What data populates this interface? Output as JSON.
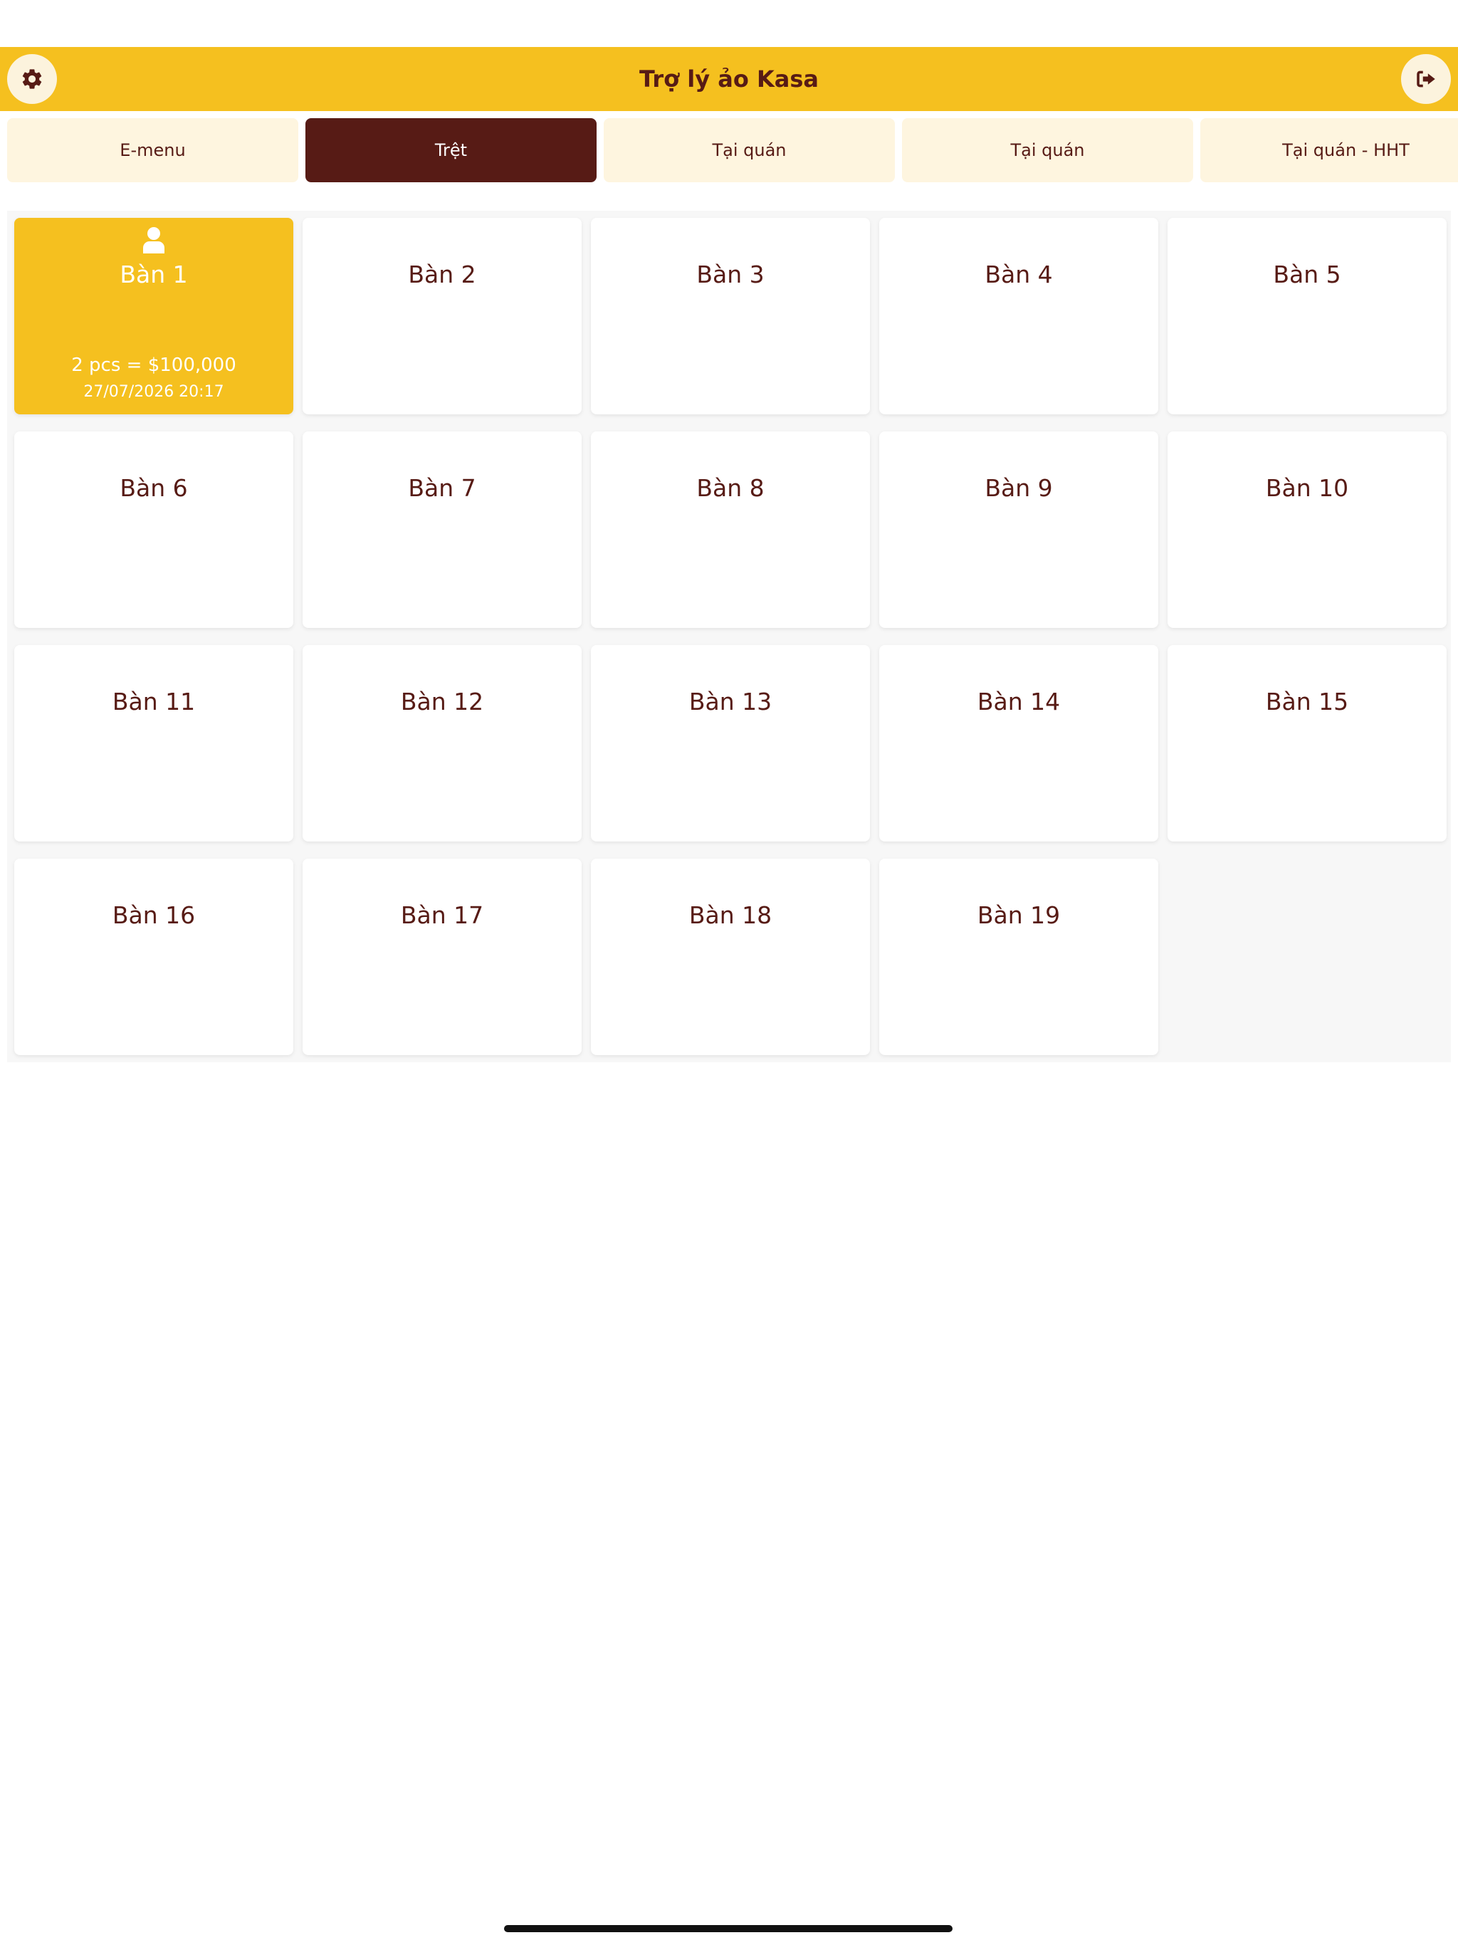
{
  "header": {
    "title": "Trợ lý ảo Kasa",
    "left_icon": "gear-icon",
    "right_icon": "sign-out-icon"
  },
  "tabs": [
    {
      "label": "E-menu",
      "active": false
    },
    {
      "label": "Trệt",
      "active": true
    },
    {
      "label": "Tại quán",
      "active": false
    },
    {
      "label": "Tại quán",
      "active": false
    },
    {
      "label": "Tại quán - HHT",
      "active": false
    }
  ],
  "tables": [
    {
      "name": "Bàn 1",
      "occupied": true,
      "summary": "2 pcs = $100,000",
      "time": "27/07/2026 20:17"
    },
    {
      "name": "Bàn 2"
    },
    {
      "name": "Bàn 3"
    },
    {
      "name": "Bàn 4"
    },
    {
      "name": "Bàn 5"
    },
    {
      "name": "Bàn 6"
    },
    {
      "name": "Bàn 7"
    },
    {
      "name": "Bàn 8"
    },
    {
      "name": "Bàn 9"
    },
    {
      "name": "Bàn 10"
    },
    {
      "name": "Bàn 11"
    },
    {
      "name": "Bàn 12"
    },
    {
      "name": "Bàn 13"
    },
    {
      "name": "Bàn 14"
    },
    {
      "name": "Bàn 15"
    },
    {
      "name": "Bàn 16"
    },
    {
      "name": "Bàn 17"
    },
    {
      "name": "Bàn 18"
    },
    {
      "name": "Bàn 19"
    }
  ],
  "colors": {
    "accent": "#F5C01F",
    "brand_dark": "#571B15",
    "tab_bg": "#FEF5DF"
  }
}
